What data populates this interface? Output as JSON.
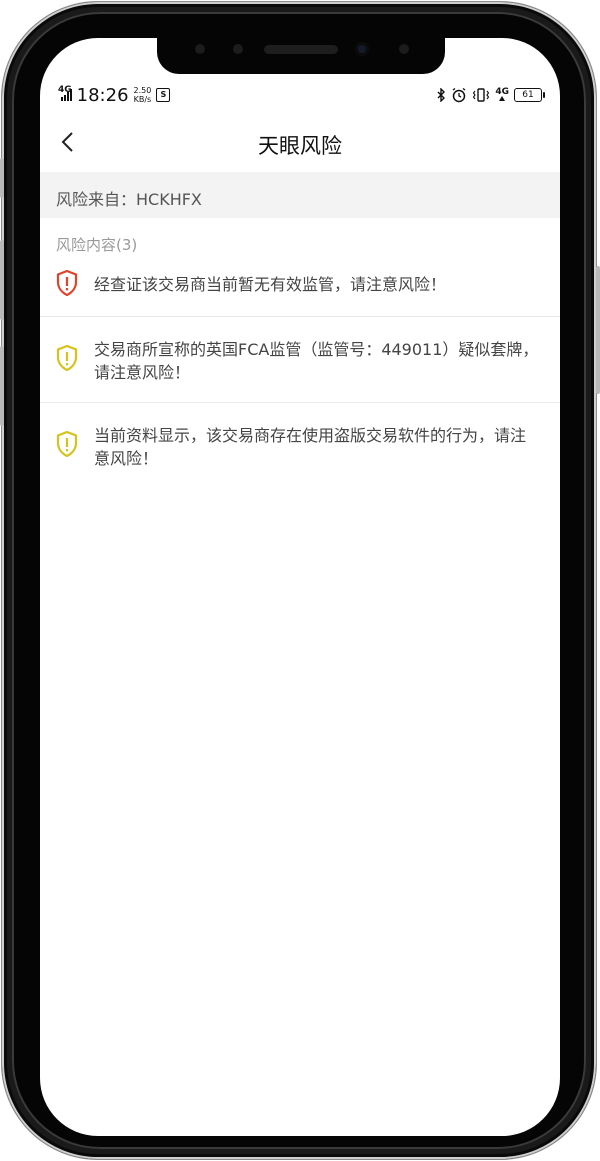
{
  "status_bar": {
    "network": "4G",
    "time": "18:26",
    "speed_value": "2.50",
    "speed_unit": "KB/s",
    "sd_icon": "sim-card-icon",
    "right_network": "4G",
    "battery": "61"
  },
  "nav": {
    "title": "天眼风险"
  },
  "source": {
    "text": "风险来自：HCKHFX"
  },
  "risks": {
    "header": "风险内容(3)",
    "items": [
      {
        "text": "经查证该交易商当前暂无有效监管，请注意风险！",
        "level": "high",
        "color": "#e0452b"
      },
      {
        "text": "交易商所宣称的英国FCA监管（监管号：449011）疑似套牌，请注意风险！",
        "level": "medium",
        "color": "#d6c21b"
      },
      {
        "text": "当前资料显示，该交易商存在使用盗版交易软件的行为，请注意风险！",
        "level": "medium",
        "color": "#d6c21b"
      }
    ]
  }
}
